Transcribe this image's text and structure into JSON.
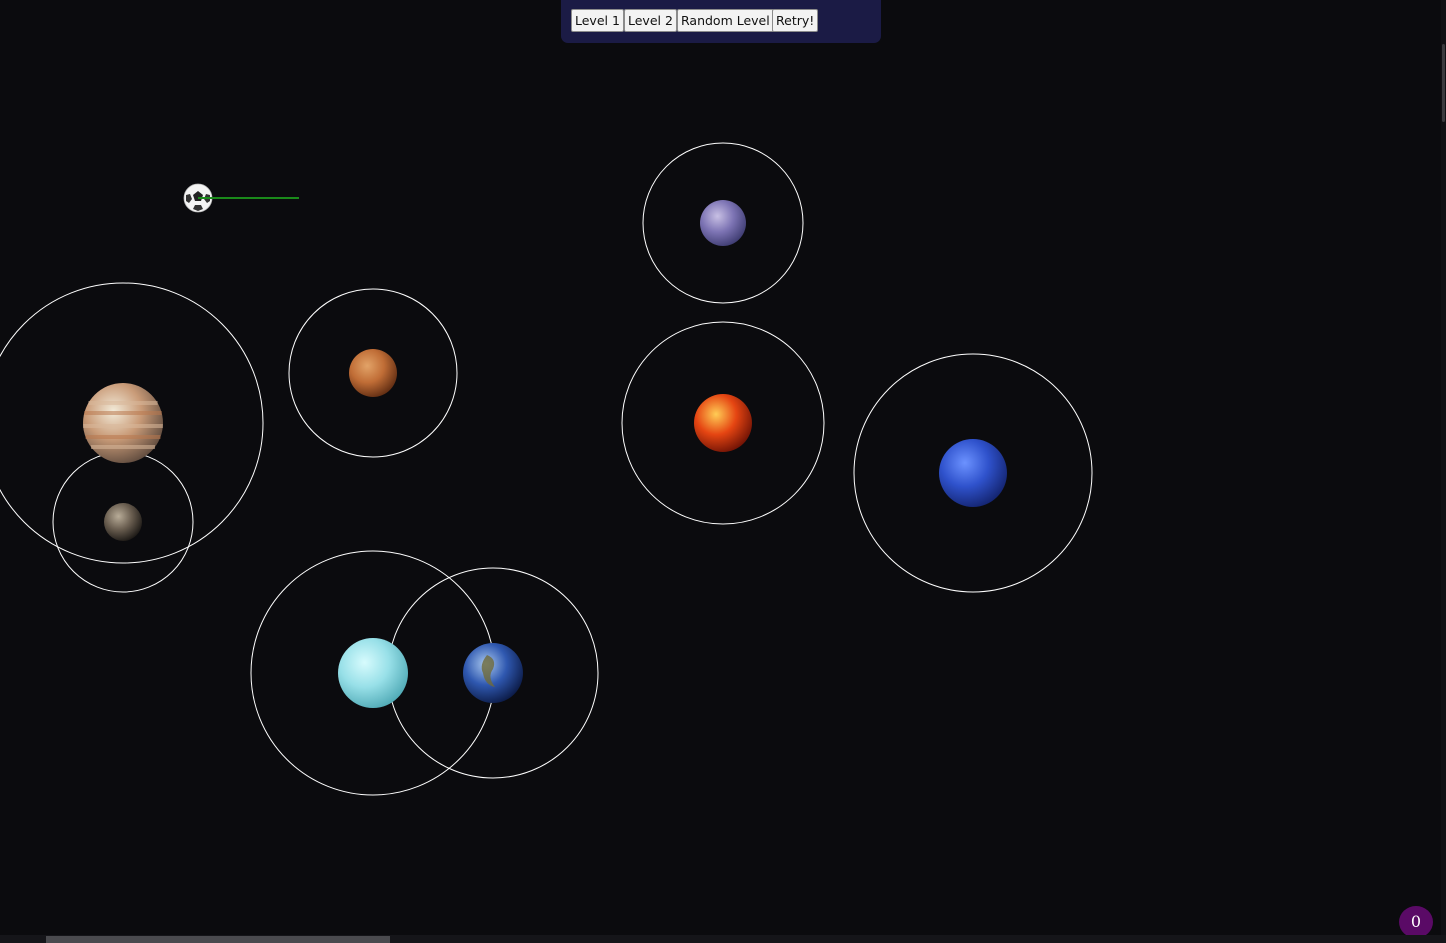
{
  "toolbar": {
    "buttons": {
      "level1": "Level 1",
      "level2": "Level 2",
      "random": "Random Level",
      "retry": "Retry!"
    }
  },
  "score": "0",
  "ship": {
    "icon": "soccer-ball-icon",
    "aim_line_color": "#1a8a1a"
  },
  "planets": [
    {
      "id": "mercury",
      "icon": "mercury-icon",
      "colors": [
        "#c8c0e4",
        "#7d74b4",
        "#3d3b70"
      ]
    },
    {
      "id": "mars",
      "icon": "mars-icon",
      "colors": [
        "#e2a368",
        "#c06d36",
        "#5f2c12"
      ]
    },
    {
      "id": "venus",
      "icon": "venus-icon",
      "colors": [
        "#ffcc55",
        "#e54512",
        "#6e1205"
      ]
    },
    {
      "id": "jupiter",
      "icon": "jupiter-icon",
      "colors": [
        "#f2ead8",
        "#c99b78",
        "#5f4b3e"
      ]
    },
    {
      "id": "moon",
      "icon": "moon-icon",
      "colors": [
        "#b8ac98",
        "#6a5e50",
        "#1a1714"
      ]
    },
    {
      "id": "neptune",
      "icon": "neptune-icon",
      "colors": [
        "#6c92ff",
        "#2f52cc",
        "#13236e"
      ]
    },
    {
      "id": "uranus",
      "icon": "uranus-icon",
      "colors": [
        "#d7fbfd",
        "#98e0e8",
        "#4fa9b5"
      ]
    },
    {
      "id": "earth",
      "icon": "earth-icon",
      "colors": [
        "#a8c7ee",
        "#2f58b0",
        "#0b1a45"
      ]
    }
  ]
}
